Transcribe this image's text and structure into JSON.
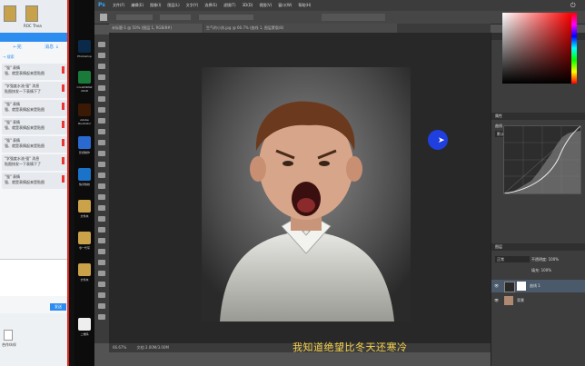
{
  "chat_window": {
    "top_icons": [
      "",
      "",
      "ROC Thea"
    ],
    "tabs": [
      "←完",
      "消息 ↓"
    ],
    "section_1": "→ 搜索",
    "messages": [
      {
        "line1": "\"强\" 表情",
        "line2": "强、就是表情起来是贴图"
      },
      {
        "line1": "\"学强度水流·强\" 消息",
        "line2": "贴图快发一下表情下了"
      },
      {
        "line1": "\"强\" 表情",
        "line2": "强、就是表情起来是贴图"
      },
      {
        "line1": "\"强\" 表情",
        "line2": "强、就是表情起来是贴图"
      },
      {
        "line1": "\"强\" 表情",
        "line2": "强、就是表情起来是贴图"
      },
      {
        "line1": "\"学强度水流·强\" 消息",
        "line2": "贴图快发一下表情下了"
      },
      {
        "line1": "\"强\" 表情",
        "line2": "强、就是表情起来是贴图"
      }
    ],
    "send_label": "发送",
    "footer_text": "合作伙伴"
  },
  "desktop_icons": [
    {
      "label": "Photoshop",
      "color": "#0b2a4a"
    },
    {
      "label": "CorelDRAW 2018",
      "color": "#1a7a3a"
    },
    {
      "label": "Adobe Illustrator",
      "color": "#3a1a05"
    },
    {
      "label": "影视制作",
      "color": "#2a6ad0"
    },
    {
      "label": "快对快校",
      "color": "#1a73c8"
    },
    {
      "label": "文件夹",
      "color": "#c9a24a"
    },
    {
      "label": "零一代写",
      "color": "#c9a24a"
    },
    {
      "label": "文件夹",
      "color": "#c9a24a"
    },
    {
      "label": "二维码",
      "color": "#eeeeee"
    }
  ],
  "photoshop": {
    "logo": "Ps",
    "menu": [
      "文件(F)",
      "编辑(E)",
      "图像(I)",
      "图层(L)",
      "文字(Y)",
      "选择(S)",
      "滤镜(T)",
      "3D(D)",
      "视图(V)",
      "窗口(W)",
      "帮助(H)"
    ],
    "tab_1": "未标题-1 @ 50% (图层 1, RGB/8#)",
    "tab_2": "生气的小孩.jpg @ 66.7% (曲线 1, 图层蒙版/8)",
    "status_zoom": "66.67%",
    "status_doc": "文档:3.00M/3.00M",
    "subtitle": "我知道绝望比冬天还寒冷",
    "properties_title": "属性",
    "curves_label": "曲线",
    "curves_preset": "默认值",
    "layers_title": "图层",
    "layer_blend": "正常",
    "layer_opacity": "不透明度: 100%",
    "layer_fill": "填充: 100%",
    "layers": [
      {
        "name": "曲线 1",
        "type": "adjustment"
      },
      {
        "name": "背景",
        "type": "image"
      }
    ]
  }
}
